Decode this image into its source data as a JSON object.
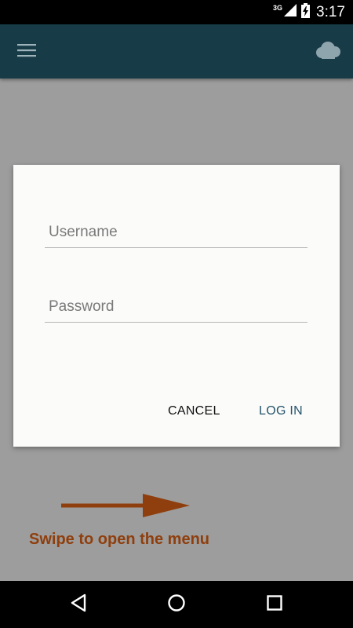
{
  "status_bar": {
    "network": "3G",
    "time": "3:17"
  },
  "app_bar": {
    "menu_icon": "hamburger-menu-icon",
    "cloud_icon": "cloud-icon",
    "background_color": "#173b47"
  },
  "login_dialog": {
    "username_placeholder": "Username",
    "username_value": "",
    "password_placeholder": "Password",
    "password_value": "",
    "cancel_label": "CANCEL",
    "login_label": "LOG IN",
    "login_color": "#25556c"
  },
  "hint": {
    "text": "Swipe to open the menu",
    "color": "#8f3f0d"
  },
  "nav_bar": {
    "back_icon": "back-triangle-icon",
    "home_icon": "home-circle-icon",
    "recents_icon": "recents-square-icon"
  }
}
